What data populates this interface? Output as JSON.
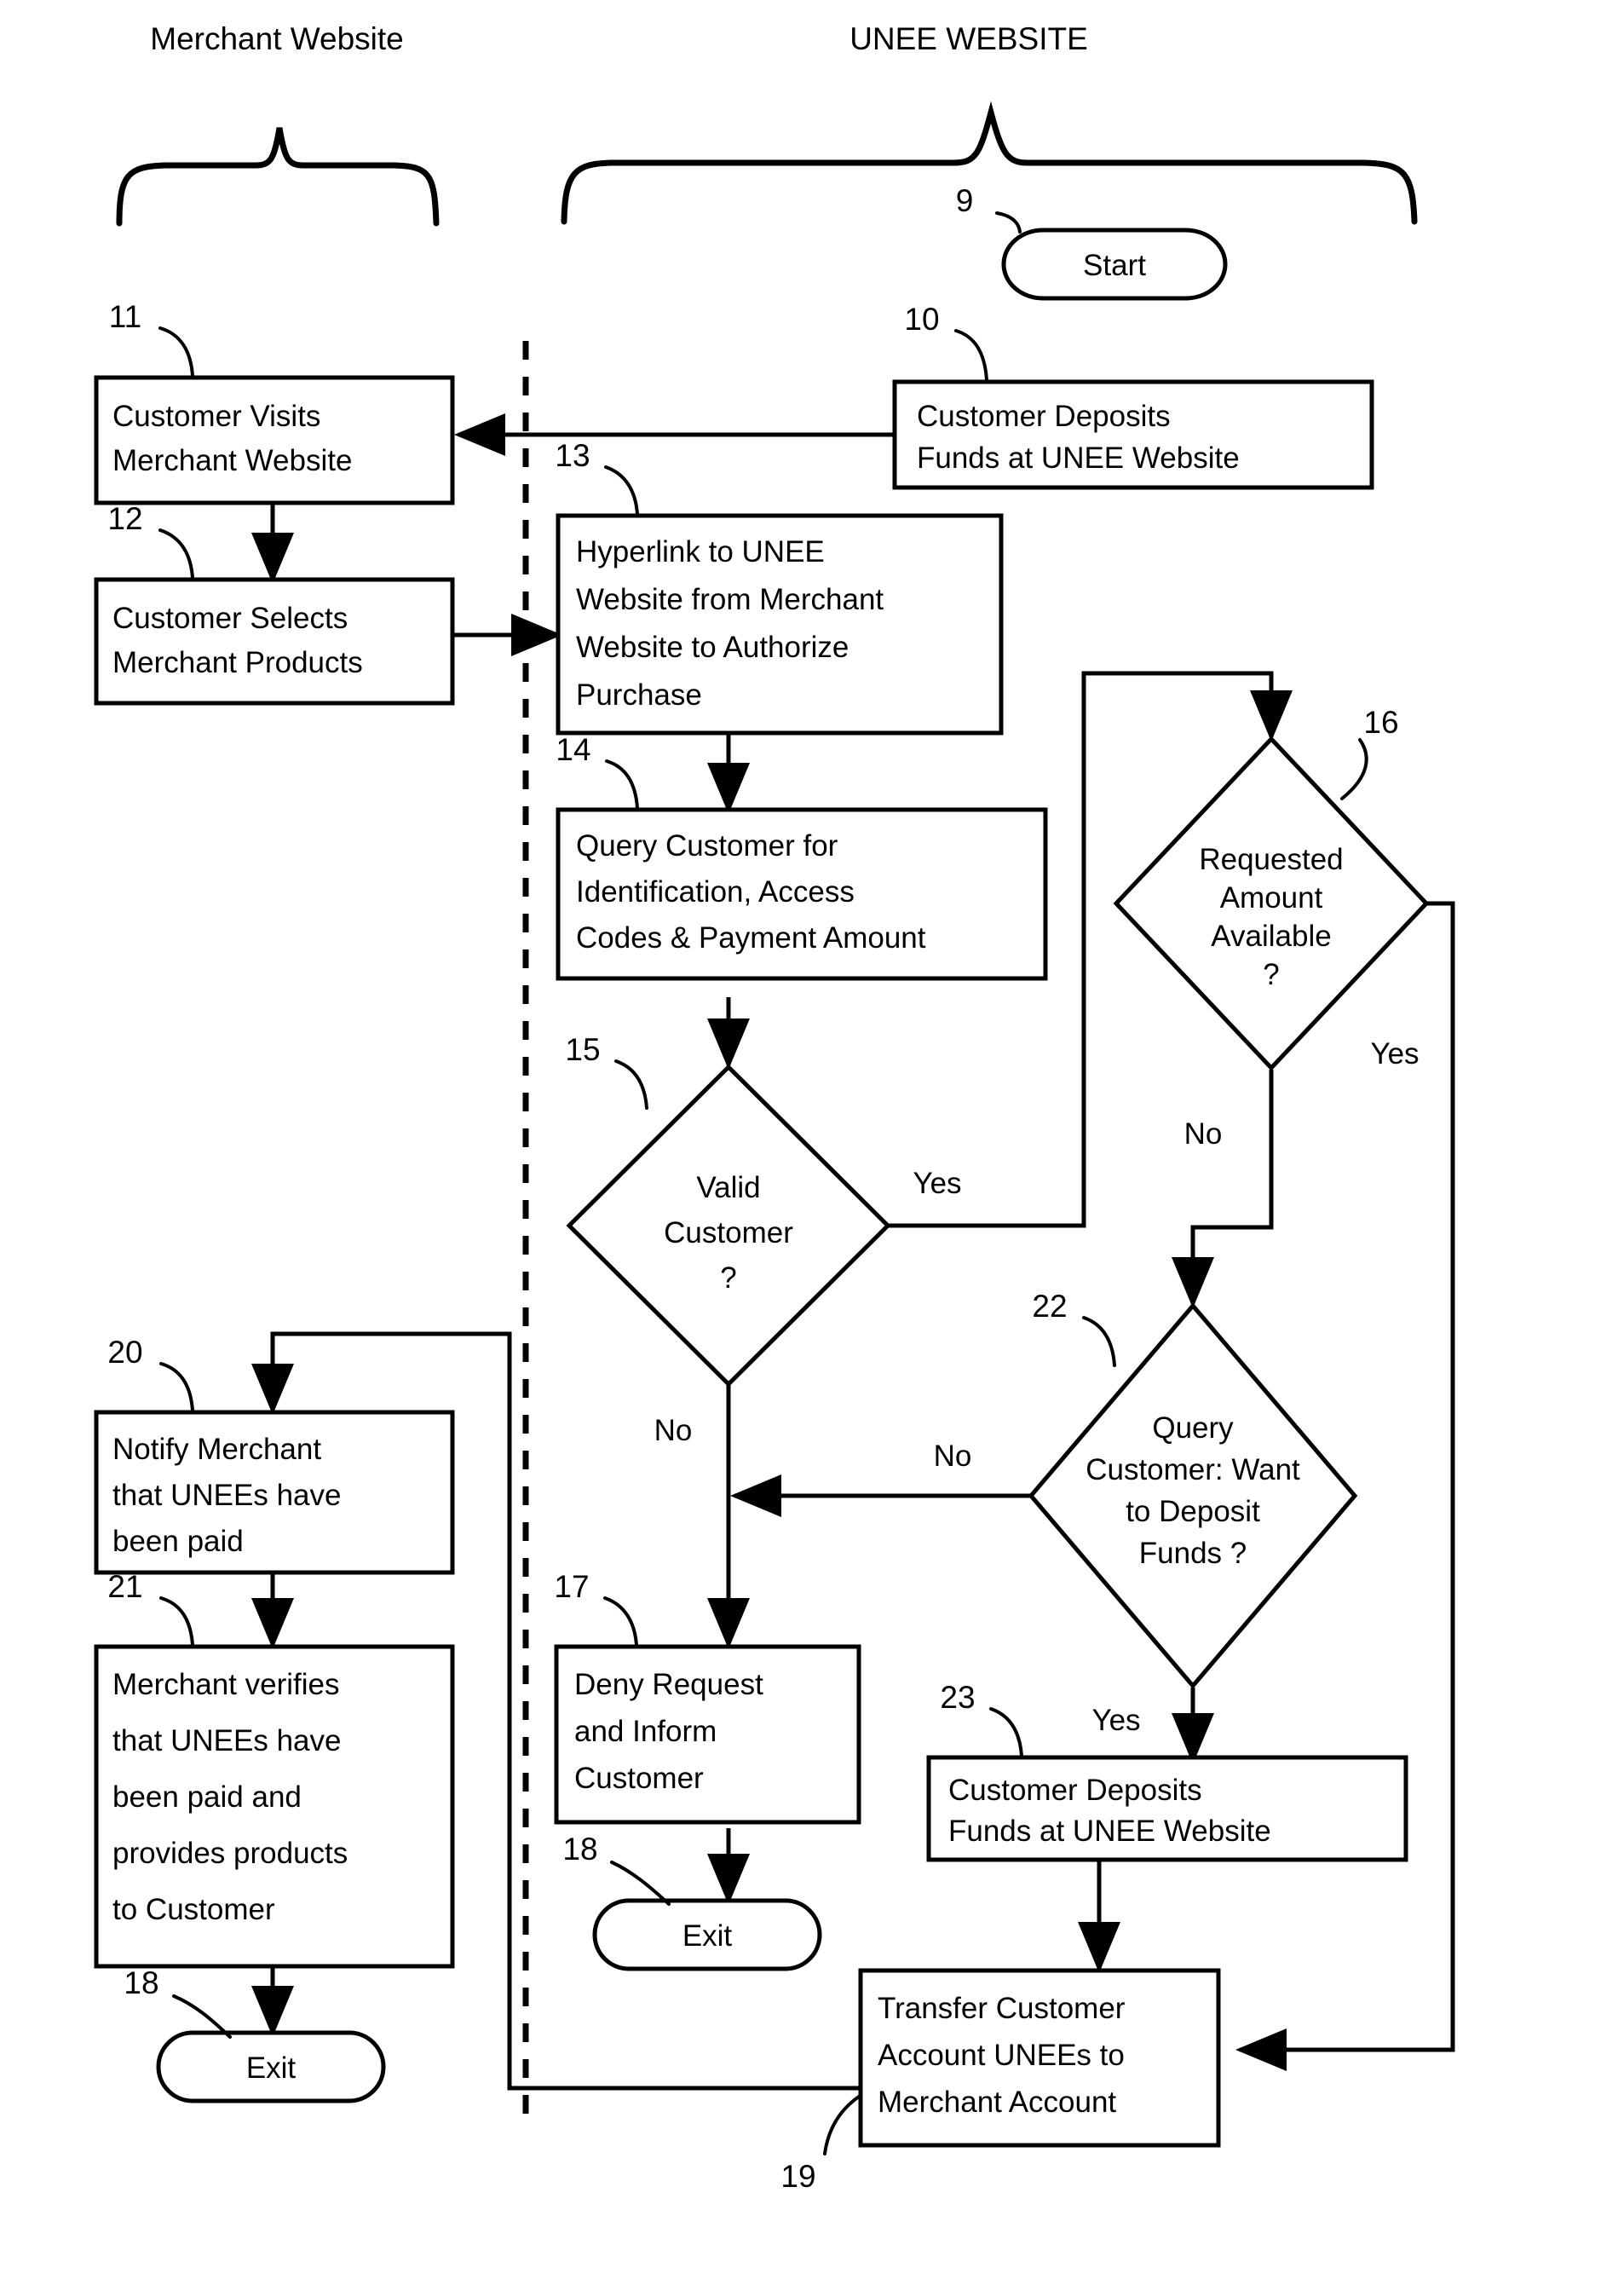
{
  "diagram": {
    "title_left": "Merchant Website",
    "title_right": "UNEE WEBSITE"
  },
  "nodes": {
    "start": {
      "ref": "9",
      "label": "Start",
      "shape": "terminator"
    },
    "n10": {
      "ref": "10",
      "line1": "Customer Deposits",
      "line2": "Funds at UNEE Website",
      "shape": "process"
    },
    "n11": {
      "ref": "11",
      "line1": "Customer Visits",
      "line2": "Merchant Website",
      "shape": "process"
    },
    "n12": {
      "ref": "12",
      "line1": "Customer Selects",
      "line2": "Merchant Products",
      "shape": "process"
    },
    "n13": {
      "ref": "13",
      "line1": "Hyperlink to UNEE",
      "line2": "Website from  Merchant",
      "line3": "Website to Authorize",
      "line4": "Purchase",
      "shape": "process"
    },
    "n14": {
      "ref": "14",
      "line1": "Query Customer for",
      "line2": "Identification, Access",
      "line3": "Codes & Payment Amount",
      "shape": "process"
    },
    "n15": {
      "ref": "15",
      "line1": "Valid",
      "line2": "Customer",
      "line3": "?",
      "shape": "decision"
    },
    "n16": {
      "ref": "16",
      "line1": "Requested",
      "line2": "Amount",
      "line3": "Available",
      "line4": "?",
      "shape": "decision"
    },
    "n17": {
      "ref": "17",
      "line1": "Deny Request",
      "line2": "and Inform",
      "line3": "Customer",
      "shape": "process"
    },
    "exit_mid": {
      "ref": "18",
      "label": "Exit",
      "shape": "terminator"
    },
    "n19": {
      "ref": "19",
      "line1": "Transfer Customer",
      "line2": "Account UNEEs to",
      "line3": "Merchant Account",
      "shape": "process"
    },
    "n20": {
      "ref": "20",
      "line1": "Notify Merchant",
      "line2": "that UNEEs have",
      "line3": "been paid",
      "shape": "process"
    },
    "n21": {
      "ref": "21",
      "line1": "Merchant verifies",
      "line2": "that UNEEs have",
      "line3": "been paid and",
      "line4": "provides products",
      "line5": "to Customer",
      "shape": "process"
    },
    "exit_left": {
      "ref": "18",
      "label": "Exit",
      "shape": "terminator"
    },
    "n22": {
      "ref": "22",
      "line1": "Query",
      "line2": "Customer: Want",
      "line3": "to Deposit",
      "line4": "Funds ?",
      "shape": "decision"
    },
    "n23": {
      "ref": "23",
      "line1": "Customer Deposits",
      "line2": "Funds at UNEE Website",
      "shape": "process"
    }
  },
  "edge_labels": {
    "valid_customer_yes": "Yes",
    "valid_customer_no": "No",
    "amount_available_yes": "Yes",
    "amount_available_no": "No",
    "deposit_query_no": "No",
    "deposit_query_yes": "Yes"
  },
  "colors": {
    "stroke": "#000000",
    "background": "#ffffff"
  }
}
